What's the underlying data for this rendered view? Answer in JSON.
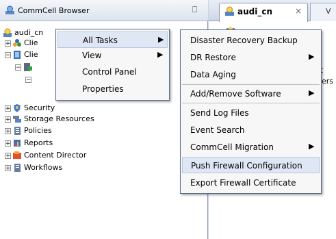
{
  "left_panel": {
    "title": "CommCell Browser",
    "pin": "⎕",
    "tree": {
      "root": "audi_cn",
      "items": [
        {
          "label": "Clie"
        },
        {
          "label": "Clie"
        },
        {
          "label": "Security"
        },
        {
          "label": "Storage Resources"
        },
        {
          "label": "Policies"
        },
        {
          "label": "Reports"
        },
        {
          "label": "Content Director"
        },
        {
          "label": "Workflows"
        }
      ]
    }
  },
  "tabs": {
    "active": "audi_cn",
    "close": "×",
    "next": "V"
  },
  "right_fragments": [
    "t",
    "ers"
  ],
  "context_menu": {
    "items": [
      {
        "label": "All Tasks",
        "arrow": "▶"
      },
      {
        "label": "View",
        "arrow": "▶"
      },
      {
        "label": "Control Panel"
      },
      {
        "label": "Properties"
      }
    ]
  },
  "submenu": {
    "items": [
      {
        "label": "Disaster Recovery Backup"
      },
      {
        "label": "DR Restore",
        "arrow": "▶"
      },
      {
        "label": "Data Aging"
      },
      {
        "label": "Add/Remove Software",
        "arrow": "▶"
      },
      {
        "label": "Send Log Files"
      },
      {
        "label": "Event Search"
      },
      {
        "label": "CommCell Migration",
        "arrow": "▶"
      },
      {
        "label": "Push Firewall Configuration"
      },
      {
        "label": "Export Firewall Certificate"
      }
    ]
  },
  "colors": {
    "accent": "#dfe7f4",
    "pane_border": "#8a9bb3"
  }
}
